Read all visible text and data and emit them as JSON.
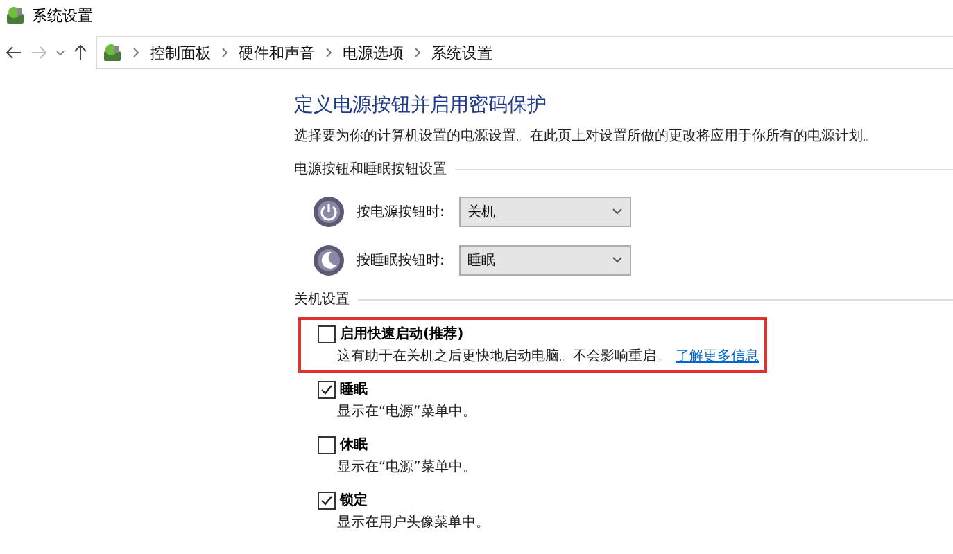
{
  "window": {
    "title": "系统设置"
  },
  "breadcrumb": [
    "控制面板",
    "硬件和声音",
    "电源选项",
    "系统设置"
  ],
  "heading": "定义电源按钮并启用密码保护",
  "description": "选择要为你的计算机设置的电源设置。在此页上对设置所做的更改将应用于你所有的电源计划。",
  "button_group": {
    "label": "电源按钮和睡眠按钮设置",
    "rows": [
      {
        "kind": "power",
        "label": "按电源按钮时:",
        "value": "关机"
      },
      {
        "kind": "sleep",
        "label": "按睡眠按钮时:",
        "value": "睡眠"
      }
    ]
  },
  "shutdown_group": {
    "label": "关机设置",
    "options": [
      {
        "label": "启用快速启动(推荐)",
        "checked": false,
        "highlighted": true,
        "description": "这有助于在关机之后更快地启动电脑。不会影响重启。",
        "link": "了解更多信息"
      },
      {
        "label": "睡眠",
        "checked": true,
        "highlighted": false,
        "description": "显示在“电源”菜单中。"
      },
      {
        "label": "休眠",
        "checked": false,
        "highlighted": false,
        "description": "显示在“电源”菜单中。"
      },
      {
        "label": "锁定",
        "checked": true,
        "highlighted": false,
        "description": "显示在用户头像菜单中。"
      }
    ]
  }
}
